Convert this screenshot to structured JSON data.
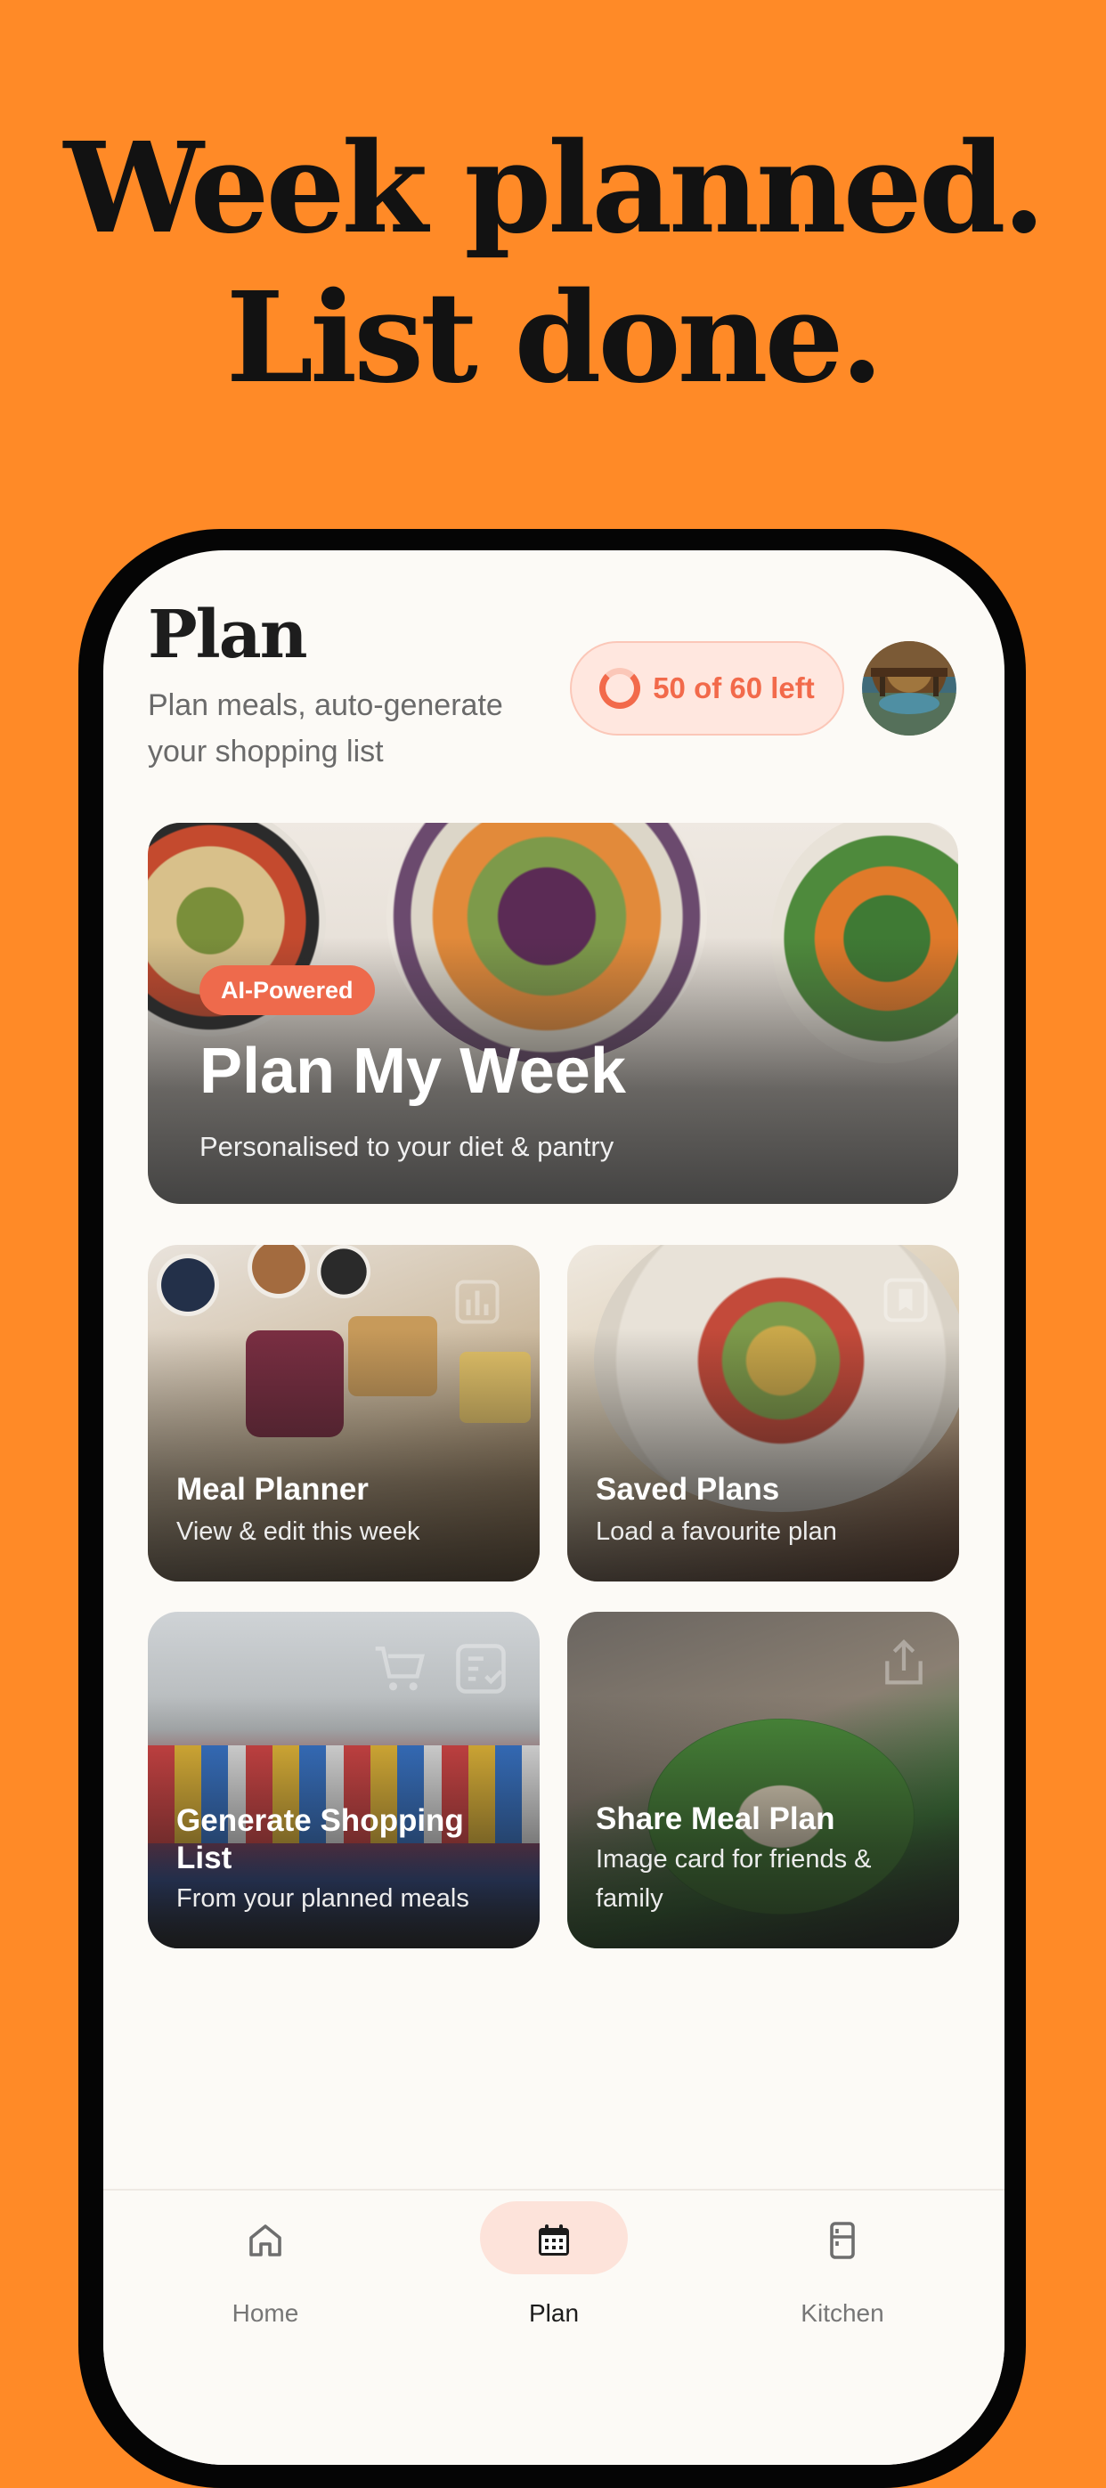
{
  "headline": {
    "line1": "Week planned.",
    "line2": "List done."
  },
  "header": {
    "title": "Plan",
    "subtitle": "Plan meals, auto-generate your shopping list",
    "quota": "50 of 60 left"
  },
  "hero": {
    "badge": "AI-Powered",
    "title": "Plan My Week",
    "subtitle": "Personalised to your diet & pantry"
  },
  "cards": [
    {
      "title": "Meal Planner",
      "subtitle": "View & edit this week"
    },
    {
      "title": "Saved Plans",
      "subtitle": "Load a favourite plan"
    },
    {
      "title": "Generate Shopping List",
      "subtitle": "From your planned meals"
    },
    {
      "title": "Share Meal Plan",
      "subtitle": "Image card for friends & family"
    }
  ],
  "tabs": [
    {
      "label": "Home",
      "icon": "home-icon"
    },
    {
      "label": "Plan",
      "icon": "calendar-icon"
    },
    {
      "label": "Kitchen",
      "icon": "fridge-icon"
    }
  ],
  "colors": {
    "background": "#FF8A27",
    "accent": "#EE6A4C",
    "screen": "#FCFAF6"
  }
}
